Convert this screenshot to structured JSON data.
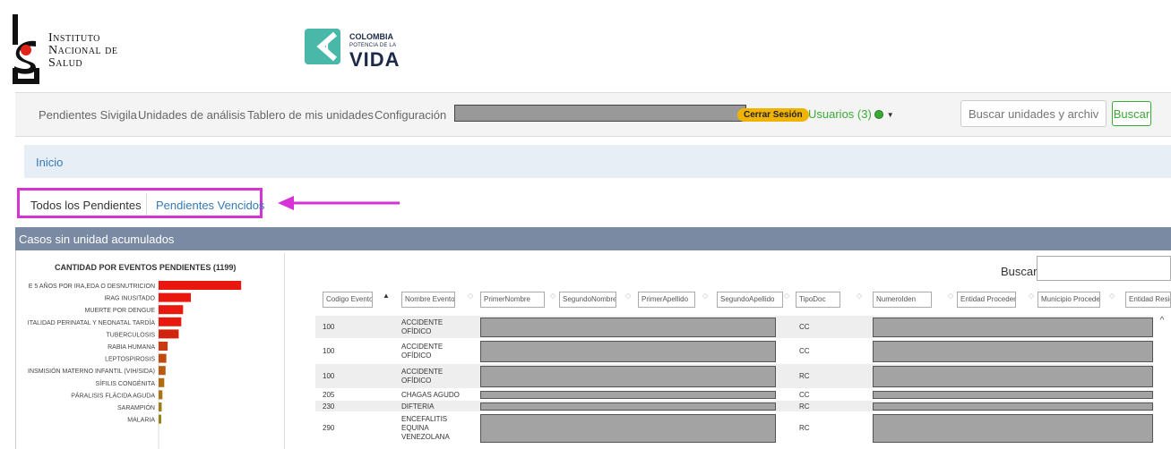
{
  "header": {
    "ins_line1": "Instituto",
    "ins_line2": "Nacional de",
    "ins_line3": "Salud",
    "colombia_title": "COLOMBIA",
    "colombia_sub1": "POTENCIA DE LA",
    "colombia_vida": "VIDA"
  },
  "nav": {
    "items": [
      "Pendientes Sivigila",
      "Unidades de análisis",
      "Tablero de mis unidades",
      "Configuración"
    ],
    "logout_label": "Cerrar Sesión",
    "users_label": "Usuarios (3)",
    "search_placeholder": "Buscar unidades y archivos",
    "search_button": "Buscar",
    "colors": {
      "green": "#3aaa35",
      "badge": "#f0b400"
    }
  },
  "breadcrumb": {
    "home": "Inicio"
  },
  "tabs": {
    "all": "Todos los Pendientes",
    "overdue": "Pendientes Vencidos"
  },
  "panel": {
    "title": "Casos sin unidad acumulados",
    "search_label": "Buscar:"
  },
  "chart_data": {
    "type": "bar",
    "orientation": "horizontal",
    "title": "CANTIDAD POR EVENTOS PENDIENTES (1199)",
    "categories": [
      "E 5 AÑOS POR IRA,EDA O DESNUTRICION",
      "IRAG INUSITADO",
      "MUERTE POR DENGUE",
      "ITALIDAD PERINATAL Y NEONATAL TARDÍA",
      "TUBERCULOSIS",
      "RABIA HUMANA",
      "LEPTOSPIROSIS",
      "INSMISIÓN MATERNO INFANTIL (VIH/SIDA)",
      "SÍFILIS CONGÉNITA",
      "PÁRALISIS FLÁCIDA AGUDA",
      "SARAMPIÓN",
      "MALARIA"
    ],
    "values": [
      320,
      125,
      95,
      88,
      78,
      35,
      30,
      27,
      22,
      15,
      12,
      8
    ],
    "colors": [
      "#e8180f",
      "#e8180f",
      "#e8180f",
      "#e8180f",
      "#d0240e",
      "#cc3b10",
      "#c04a10",
      "#b85a12",
      "#b06a14",
      "#a87416",
      "#a07c18",
      "#98821a"
    ],
    "xlim": [
      0,
      400
    ]
  },
  "table": {
    "columns": [
      "Codigo Evento",
      "Nombre Evento",
      "PrimerNombre",
      "SegundoNombre",
      "PrimerApellido",
      "SegundoApellido",
      "TipoDoc",
      "NumeroIden",
      "Entidad Procedencia",
      "Municipio Procedencia",
      "Entidad Residencia"
    ],
    "rows": [
      {
        "codigo": "100",
        "nombre": [
          "ACCIDENTE",
          "OFÍDICO"
        ],
        "tipo": "CC"
      },
      {
        "codigo": "100",
        "nombre": [
          "ACCIDENTE",
          "OFÍDICO"
        ],
        "tipo": "CC"
      },
      {
        "codigo": "100",
        "nombre": [
          "ACCIDENTE",
          "OFÍDICO"
        ],
        "tipo": "RC"
      },
      {
        "codigo": "205",
        "nombre": [
          "CHAGAS AGUDO"
        ],
        "tipo": "CC"
      },
      {
        "codigo": "230",
        "nombre": [
          "DIFTERIA"
        ],
        "tipo": "RC"
      },
      {
        "codigo": "290",
        "nombre": [
          "ENCEFALITIS",
          "EQUINA",
          "VENEZOLANA"
        ],
        "tipo": "RC"
      }
    ]
  }
}
